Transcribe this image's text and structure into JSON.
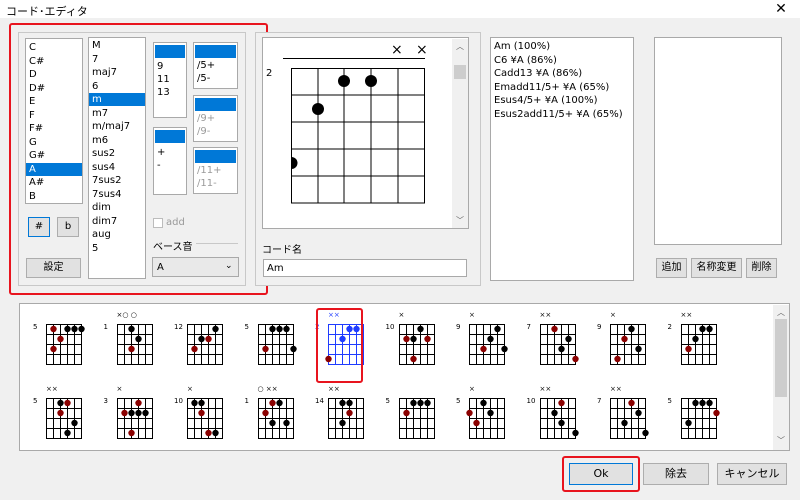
{
  "window": {
    "title": "コード･エディタ",
    "close_glyph": "✕"
  },
  "roots": [
    "C",
    "C#",
    "D",
    "D#",
    "E",
    "F",
    "F#",
    "G",
    "G#",
    "A",
    "A#",
    "B"
  ],
  "roots_selected": "A",
  "accidentals": {
    "sharp": "#",
    "flat": "b"
  },
  "settings_button": "設定",
  "qualities": [
    "M",
    "7",
    "maj7",
    "6",
    "m",
    "m7",
    "m/maj7",
    "m6",
    "sus2",
    "sus4",
    "7sus2",
    "7sus4",
    "dim",
    "dim7",
    "aug",
    "5"
  ],
  "qualities_selected": "m",
  "tensions_9": [
    "9",
    "11",
    "13"
  ],
  "tensions_plusminus": [
    "+",
    "-"
  ],
  "fifth_mods": [
    "/5+",
    "/5-"
  ],
  "ninth_mods": [
    "/9+",
    "/9-"
  ],
  "eleventh_mods": [
    "/11+",
    "/11-"
  ],
  "add_label": "add",
  "bass_label": "ベース音",
  "bass_value": "A",
  "chord_name_label": "コード名",
  "chord_name_value": "Am",
  "diagram": {
    "start_fret": "2",
    "muted": [
      "×",
      "×"
    ]
  },
  "chord_candidates": [
    "Am (100%)",
    "C6 ¥A (86%)",
    "Cadd13 ¥A (86%)",
    "Emadd11/5+ ¥A (65%)",
    "Esus4/5+ ¥A (100%)",
    "Esus2add11/5+ ¥A (65%)"
  ],
  "right_buttons": {
    "add": "追加",
    "rename": "名称変更",
    "delete": "削除"
  },
  "voicings_row1": [
    {
      "fret": "5",
      "marks": ""
    },
    {
      "fret": "1",
      "marks": "×○ ○"
    },
    {
      "fret": "12",
      "marks": ""
    },
    {
      "fret": "5",
      "marks": ""
    },
    {
      "fret": "2",
      "marks": "××"
    },
    {
      "fret": "10",
      "marks": "×"
    },
    {
      "fret": "9",
      "marks": "×"
    },
    {
      "fret": "7",
      "marks": "××"
    },
    {
      "fret": "9",
      "marks": "×"
    },
    {
      "fret": "2",
      "marks": "××"
    }
  ],
  "voicings_row2": [
    {
      "fret": "5",
      "marks": "××"
    },
    {
      "fret": "3",
      "marks": "×"
    },
    {
      "fret": "10",
      "marks": "×"
    },
    {
      "fret": "1",
      "marks": "○ ××"
    },
    {
      "fret": "14",
      "marks": "××"
    },
    {
      "fret": "5",
      "marks": ""
    },
    {
      "fret": "5",
      "marks": "×"
    },
    {
      "fret": "10",
      "marks": "××"
    },
    {
      "fret": "7",
      "marks": "××"
    },
    {
      "fret": "5",
      "marks": ""
    }
  ],
  "footer_buttons": {
    "ok": "Ok",
    "remove": "除去",
    "cancel": "キャンセル"
  },
  "colors": {
    "accent": "#0078d7",
    "highlight": "#e8141e",
    "root_dot": "#8b0000"
  }
}
